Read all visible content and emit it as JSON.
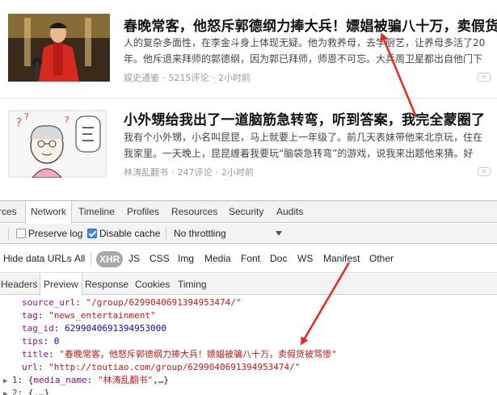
{
  "articles": [
    {
      "title": "春晚常客，他怒斥郭德纲力捧大兵！嫖娼被骗八十万，卖假货被骂惨",
      "abstract": "人的复杂多面性，在李金斗身上体现无疑。他为救养母，去学厨艺，让养母多活了20年。他斥退来拜师的郭德纲，因为郭已拜师，师恩不可忘。大兵周卫星都出自他门下",
      "source": "娱史通鉴",
      "comments": "5215评论",
      "time": "2小时前",
      "dislike": "✕"
    },
    {
      "title": "小外甥给我出了一道脑筋急转弯，听到答案，我完全蒙圈了",
      "abstract": "我有个小外甥，小名叫昆昆，马上就要上一年级了。前几天表妹带他来北京玩，住在我家里。一天晚上，昆昆缠着我要玩“脑袋急转弯”的游戏，说我来出题他来猜。好吧，我就",
      "source": "林涛乱翻书",
      "comments": "247评论",
      "time": "2小时前",
      "dislike": "✕"
    }
  ],
  "devtools": {
    "main_tabs": [
      "rces",
      "Network",
      "Timeline",
      "Profiles",
      "Resources",
      "Security",
      "Audits"
    ],
    "active_main_tab": "Network",
    "preserve_log_label": "Preserve log",
    "preserve_log_checked": false,
    "disable_cache_label": "Disable cache",
    "disable_cache_checked": true,
    "throttling_label": "No throttling",
    "filters": [
      "Hide data URLs",
      "All",
      "XHR",
      "JS",
      "CSS",
      "Img",
      "Media",
      "Font",
      "Doc",
      "WS",
      "Manifest",
      "Other"
    ],
    "active_filter": "XHR",
    "sub_tabs": [
      "Headers",
      "Preview",
      "Response",
      "Cookies",
      "Timing"
    ],
    "active_sub_tab": "Preview",
    "preview": {
      "source_url_key": "source_url",
      "source_url_val": "\"/group/6299040691394953474/\"",
      "tag_key": "tag",
      "tag_val": "\"news_entertainment\"",
      "tag_id_key": "tag_id",
      "tag_id_val": "6299040691394953000",
      "tips_key": "tips",
      "tips_val": "0",
      "title_key": "title",
      "title_val": "\"春晚常客，他怒斥郭德纲力捧大兵！嫖娼被骗八十万，卖假货被骂惨\"",
      "url_key": "url",
      "url_val": "\"http://toutiao.com/group/6299040691394953474/\"",
      "item1_index": "1",
      "item1_key": "media_name",
      "item1_val": "\"林涛乱翻书\"",
      "item1_tail": ",…}",
      "item2_index": "2",
      "item2_tail": "{,…}"
    }
  },
  "colors": {
    "arrow": "#e8271e",
    "xhr_pill": "#a8a8a8",
    "checkbox_checked": "#3b88f5"
  }
}
